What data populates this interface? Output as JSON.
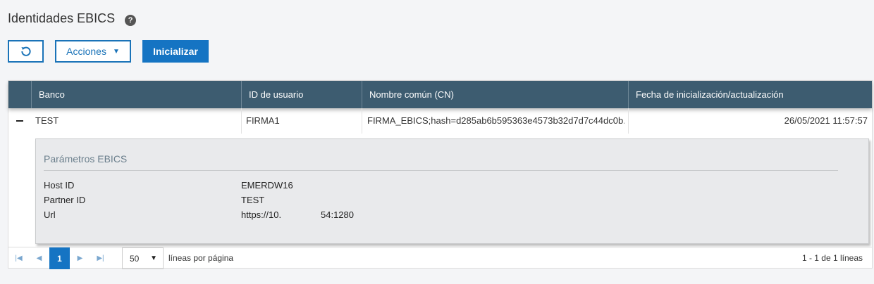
{
  "page": {
    "title": "Identidades EBICS",
    "help_icon": "question-circle-icon"
  },
  "toolbar": {
    "refresh_icon": "refresh-icon",
    "actions_label": "Acciones",
    "initialize_label": "Inicializar"
  },
  "table": {
    "columns": [
      "Banco",
      "ID de usuario",
      "Nombre común (CN)",
      "Fecha de inicialización/actualización"
    ],
    "rows": [
      {
        "bank": "TEST",
        "user_id": "FIRMA1",
        "common_name": "FIRMA_EBICS;hash=d285ab6b595363e4573b32d7d7c44dc0b...",
        "date": "26/05/2021 11:57:57"
      }
    ]
  },
  "detail": {
    "title": "Parámetros EBICS",
    "params": [
      {
        "label": "Host ID",
        "value": "EMERDW16"
      },
      {
        "label": "Partner ID",
        "value": "TEST"
      },
      {
        "label": "Url",
        "value_start": "https://10.",
        "value_end": "54:1280"
      }
    ]
  },
  "pager": {
    "current_page": "1",
    "per_page": "50",
    "per_page_label": "líneas por página",
    "summary": "1 - 1 de 1 líneas"
  },
  "colors": {
    "header": "#3d5c70",
    "primary": "#1574c3"
  }
}
